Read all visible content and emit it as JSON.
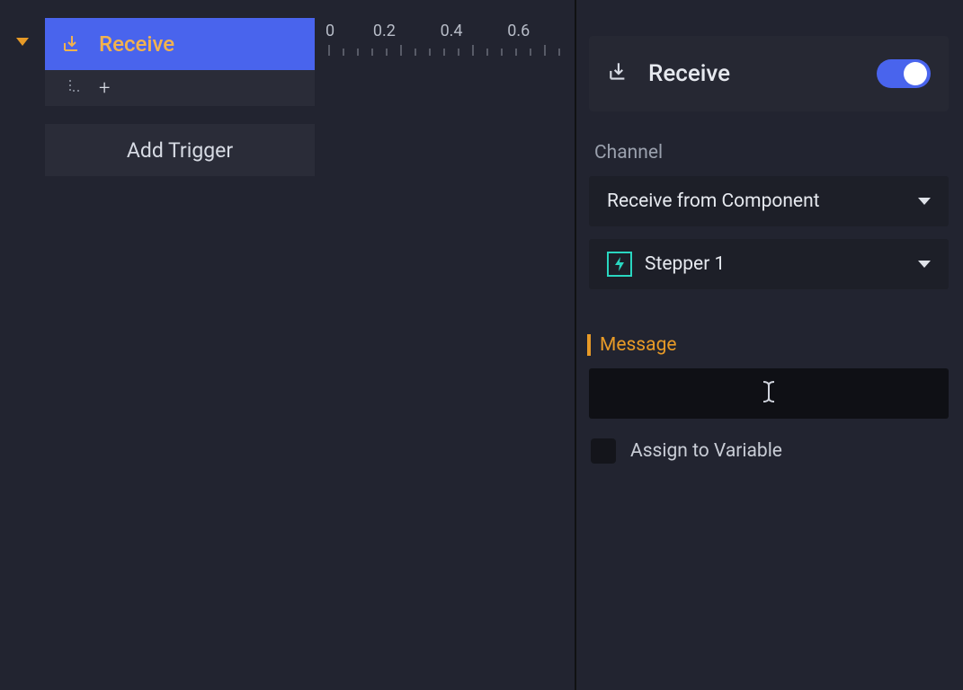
{
  "left": {
    "trigger_label": "Receive",
    "add_trigger": "Add Trigger",
    "plus": "+"
  },
  "timeline": {
    "ticks": [
      "0",
      "0.2",
      "0.4",
      "0.6"
    ]
  },
  "inspector": {
    "title": "Receive",
    "toggle_on": true,
    "channel_label": "Channel",
    "channel_mode": "Receive from Component",
    "component_name": "Stepper 1",
    "message_label": "Message",
    "message_value": "",
    "assign_label": "Assign to Variable",
    "assign_checked": false
  },
  "icons": {
    "receive": "receive-icon",
    "branch": "branch-icon",
    "bolt": "bolt-icon",
    "chevron_down": "chevron-down-icon",
    "caret": "caret-down-icon"
  }
}
